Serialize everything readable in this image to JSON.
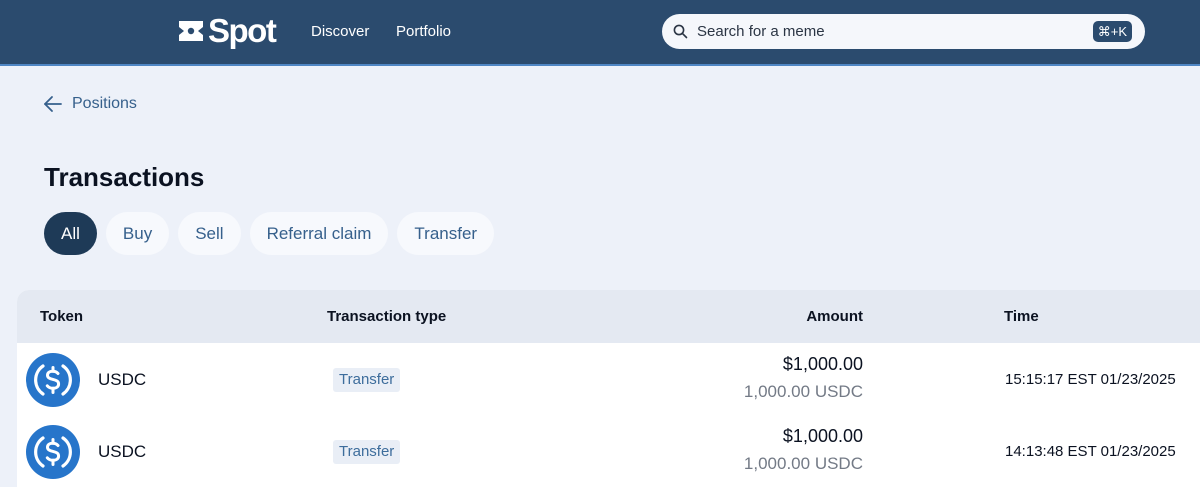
{
  "header": {
    "brand": "Spot",
    "nav": [
      {
        "label": "Discover"
      },
      {
        "label": "Portfolio"
      }
    ],
    "search": {
      "placeholder": "Search for a meme",
      "shortcut": "⌘+K"
    }
  },
  "back_link": {
    "label": "Positions"
  },
  "page_title": "Transactions",
  "filters": [
    {
      "label": "All",
      "active": true
    },
    {
      "label": "Buy",
      "active": false
    },
    {
      "label": "Sell",
      "active": false
    },
    {
      "label": "Referral claim",
      "active": false
    },
    {
      "label": "Transfer",
      "active": false
    }
  ],
  "table": {
    "columns": [
      "Token",
      "Transaction type",
      "Amount",
      "Time"
    ],
    "rows": [
      {
        "token": "USDC",
        "type": "Transfer",
        "amount_usd": "$1,000.00",
        "amount_token": "1,000.00 USDC",
        "time": "15:15:17 EST 01/23/2025"
      },
      {
        "token": "USDC",
        "type": "Transfer",
        "amount_usd": "$1,000.00",
        "amount_token": "1,000.00 USDC",
        "time": "14:13:48 EST 01/23/2025"
      }
    ]
  },
  "colors": {
    "header_bg": "#2b4b6e",
    "page_bg": "#edf1f9",
    "active_chip": "#1e3a57",
    "accent": "#36608c",
    "usdc_blue": "#2775ca"
  },
  "icons": {
    "brand_mark": "spot-logo-icon",
    "search": "search-icon",
    "back": "arrow-left-icon",
    "token": "usdc-coin-icon"
  }
}
